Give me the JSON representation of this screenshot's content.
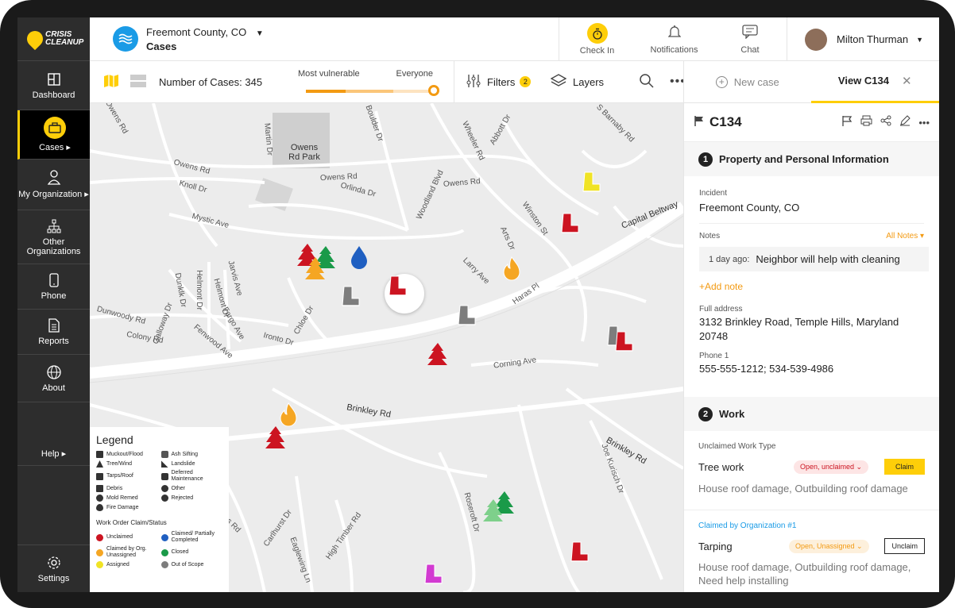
{
  "logo": {
    "line1": "CRISIS",
    "line2": "CLEANUP"
  },
  "sidebar": {
    "items": [
      {
        "label": "Dashboard",
        "icon": "dashboard-icon"
      },
      {
        "label": "Cases ▸",
        "icon": "briefcase-icon"
      },
      {
        "label": "My Organization ▸",
        "icon": "org-icon"
      },
      {
        "label": "Other Organizations",
        "icon": "hierarchy-icon"
      },
      {
        "label": "Phone",
        "icon": "phone-icon"
      },
      {
        "label": "Reports",
        "icon": "report-icon"
      },
      {
        "label": "About",
        "icon": "globe-icon"
      },
      {
        "label": "Help ▸",
        "icon": ""
      }
    ],
    "settings": "Settings"
  },
  "header": {
    "incident": "Freemont County, CO",
    "section": "Cases",
    "checkin": "Check In",
    "notifications": "Notifications",
    "chat": "Chat",
    "user": "Milton Thurman"
  },
  "toolbar": {
    "cases_label": "Number of Cases: 345",
    "most_vulnerable": "Most vulnerable",
    "everyone": "Everyone",
    "filters": "Filters",
    "filters_count": "2",
    "layers": "Layers"
  },
  "map": {
    "roads": [
      "Owens Rd",
      "Owens Rd",
      "Owens Rd",
      "Owens Rd Park",
      "Knoll Dr",
      "Martin Dr",
      "Boulder Dr",
      "Wheeler Rd",
      "Abbott Dr",
      "S Barnaby Rd",
      "Orlinda Dr",
      "Woodland Blvd",
      "Mystic Ave",
      "Winston St",
      "Capital Beltway",
      "Arts Dr",
      "Larry Ave",
      "Haras Pl",
      "Jarvis Ave",
      "Dunklk Dr",
      "Helmont Dr",
      "Helmont Dr",
      "Chloe Dr",
      "Fargo Ave",
      "Dunwoody Rd",
      "Galloway Dr",
      "Colony Rd",
      "Fenwood Ave",
      "Fenwood Dr",
      "Ironto Dr",
      "Corning Ave",
      "Brinkley Rd",
      "Brinkley Rd",
      "Joe Kurisch Dr",
      "Roseroft Dr",
      "S Barnabas Rd",
      "Carlhurst Dr",
      "High Timber Rd",
      "Eaglewing Ln"
    ],
    "colors": {
      "red": "#cc1421",
      "gray": "#7d7d7d",
      "yellow": "#f0e325",
      "green": "#1a9a49",
      "orange": "#f5a623",
      "blue": "#1f5fc1",
      "purple": "#d23ad1",
      "lightgreen": "#7ed08b"
    }
  },
  "legend": {
    "title": "Legend",
    "types": [
      "Muckout/Flood",
      "Ash Sifting",
      "Tree/Wind",
      "Landslide",
      "Tarps/Roof",
      "Deferred Maintenance",
      "Debris",
      "Other",
      "Mold Remed",
      "Rejected",
      "Fire Damage"
    ],
    "status_title": "Work Order Claim/Status",
    "statuses": [
      {
        "label": "Unclaimed",
        "color": "#cc1421"
      },
      {
        "label": "Claimed/ Partially Completed",
        "color": "#1f5fc1"
      },
      {
        "label": "Claimed by Org. Unassigned",
        "color": "#f5a623"
      },
      {
        "label": "Closed",
        "color": "#1a9a49"
      },
      {
        "label": "Assigned",
        "color": "#f0e325"
      },
      {
        "label": "Out of Scope",
        "color": "#7d7d7d"
      }
    ]
  },
  "panel": {
    "new_case": "New case",
    "view_case": "View C134",
    "case_id": "C134",
    "section1": "Property and Personal Information",
    "section1_num": "1",
    "incident_label": "Incident",
    "incident_value": "Freemont County, CO",
    "notes_label": "Notes",
    "all_notes": "All Notes ▾",
    "note_time": "1 day ago:",
    "note_text": "Neighbor will help with cleaning",
    "add_note": "+Add note",
    "address_label": "Full address",
    "address_value": "3132 Brinkley Road, Temple Hills, Maryland 20748",
    "phone_label": "Phone 1",
    "phone_value": "555-555-1212; 534-539-4986",
    "section2": "Work",
    "section2_num": "2",
    "unclaimed_type": "Unclaimed Work Type",
    "work1": "Tree work",
    "work1_status": "Open, unclaimed ⌄",
    "work1_btn": "Claim",
    "work1_desc": "House roof damage, Outbuilding roof damage",
    "claimed_by": "Claimed by Organization #1",
    "work2": "Tarping",
    "work2_status": "Open, Unassigned ⌄",
    "work2_btn": "Unclaim",
    "work2_desc": "House roof damage, Outbuilding roof damage, Need help installing"
  }
}
